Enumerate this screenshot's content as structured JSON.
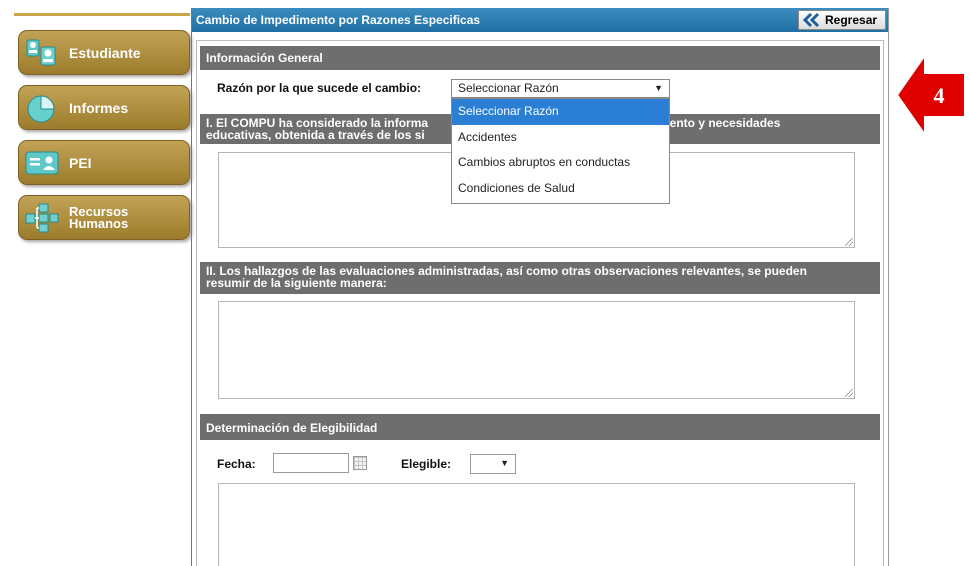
{
  "sidebar": {
    "items": [
      {
        "label": "Estudiante",
        "icon": "students-icon"
      },
      {
        "label": "Informes",
        "icon": "pie-chart-icon"
      },
      {
        "label": "PEI",
        "icon": "id-card-icon"
      },
      {
        "label": "Recursos Humanos",
        "label_line1": "Recursos",
        "label_line2": "Humanos",
        "icon": "org-chart-icon"
      }
    ]
  },
  "header": {
    "title": "Cambio de Impedimento por Razones Especificas",
    "back_label": "Regresar"
  },
  "general": {
    "section_title": "Información General",
    "reason_label": "Razón por la que sucede el cambio:",
    "reason_selected": "Seleccionar Razón",
    "reason_options": [
      "Seleccionar Razón",
      "Accidentes",
      "Cambios abruptos en conductas",
      "Condiciones de Salud"
    ]
  },
  "compu": {
    "section_line1": "I. El COMPU ha considerado la informa",
    "section_line1_end": "niento y necesidades",
    "section_line2": "educativas, obtenida a través de los si"
  },
  "hallazgos": {
    "section_line1": "II. Los hallazgos de las evaluaciones administradas, así como otras observaciones relevantes, se pueden",
    "section_line2": "resumir de la siguiente manera:"
  },
  "elegibilidad": {
    "section_title": "Determinación de Elegibilidad",
    "fecha_label": "Fecha:",
    "fecha_value": "",
    "elegible_label": "Elegible:",
    "elegible_value": ""
  },
  "annotation": {
    "number": "4",
    "color": "#e00000"
  },
  "colors": {
    "header_blue": "#1f6fa3",
    "sidebar_gold": "#b0903f",
    "section_gray": "#6e6e6e",
    "selected_option": "#2a7fd4"
  }
}
